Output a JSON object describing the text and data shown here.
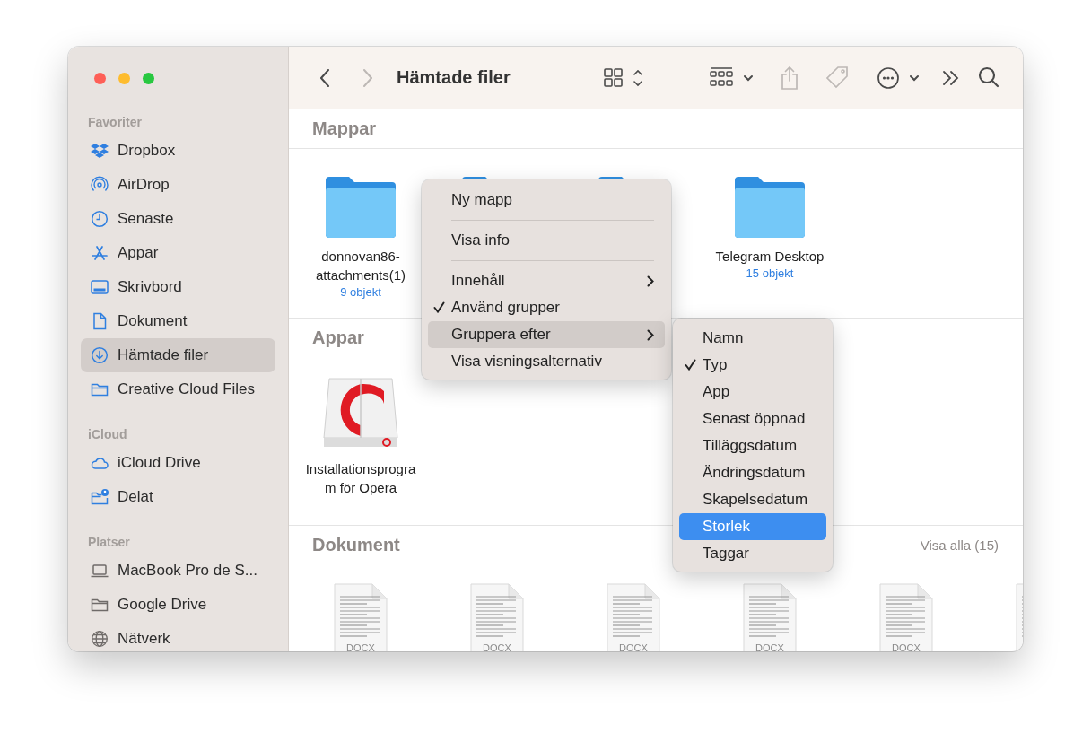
{
  "window": {
    "title": "Hämtade filer"
  },
  "toolbar": [
    {
      "kind": "back",
      "disabled": false
    },
    {
      "kind": "forward",
      "disabled": true
    },
    {
      "kind": "view",
      "disabled": false
    },
    {
      "kind": "group",
      "disabled": false
    },
    {
      "kind": "share",
      "disabled": true
    },
    {
      "kind": "tag",
      "disabled": true
    },
    {
      "kind": "more",
      "disabled": false
    },
    {
      "kind": "overflow",
      "disabled": false
    },
    {
      "kind": "search",
      "disabled": false
    }
  ],
  "sidebar": {
    "sections": [
      {
        "title": "Favoriter",
        "items": [
          {
            "label": "Dropbox",
            "kind": "dropbox",
            "selected": false
          },
          {
            "label": "AirDrop",
            "kind": "airdrop",
            "selected": false
          },
          {
            "label": "Senaste",
            "kind": "clock",
            "selected": false
          },
          {
            "label": "Appar",
            "kind": "apps",
            "selected": false
          },
          {
            "label": "Skrivbord",
            "kind": "desktop",
            "selected": false
          },
          {
            "label": "Dokument",
            "kind": "document",
            "selected": false
          },
          {
            "label": "Hämtade filer",
            "kind": "download",
            "selected": true
          },
          {
            "label": "Creative Cloud Files",
            "kind": "folder",
            "selected": false
          }
        ]
      },
      {
        "title": "iCloud",
        "items": [
          {
            "label": "iCloud Drive",
            "kind": "cloud",
            "selected": false
          },
          {
            "label": "Delat",
            "kind": "shared",
            "selected": false
          }
        ]
      },
      {
        "title": "Platser",
        "items": [
          {
            "label": "MacBook Pro de S...",
            "kind": "laptop",
            "selected": false
          },
          {
            "label": "Google Drive",
            "kind": "drive-folder",
            "selected": false
          },
          {
            "label": "Nätverk",
            "kind": "globe",
            "selected": false
          }
        ]
      }
    ]
  },
  "content": {
    "sections": [
      {
        "title": "Mappar",
        "items": [
          {
            "kind": "folder",
            "name": "donnovan86-attachments(1)",
            "count": "9 objekt"
          },
          {
            "kind": "folder"
          },
          {
            "kind": "folder"
          },
          {
            "kind": "folder",
            "name": "Telegram Desktop",
            "count": "15 objekt"
          }
        ]
      },
      {
        "title": "Appar",
        "items": [
          {
            "kind": "app",
            "name": "Installationsprogram för Opera"
          }
        ]
      },
      {
        "title": "Dokument",
        "action": "Visa alla (15)",
        "items": [
          {
            "kind": "document",
            "badge": "DOCX"
          },
          {
            "kind": "document",
            "badge": "DOCX"
          },
          {
            "kind": "document",
            "badge": "DOCX"
          },
          {
            "kind": "document",
            "badge": "DOCX"
          },
          {
            "kind": "document",
            "badge": "DOCX"
          },
          {
            "kind": "document"
          }
        ]
      }
    ]
  },
  "context_menu": {
    "items": [
      {
        "kind": "item",
        "label": "Ny mapp",
        "checked": false,
        "submenu": false,
        "highlighted": false
      },
      {
        "kind": "separator"
      },
      {
        "kind": "item",
        "label": "Visa info",
        "checked": false,
        "submenu": false,
        "highlighted": false
      },
      {
        "kind": "separator"
      },
      {
        "kind": "item",
        "label": "Innehåll",
        "checked": false,
        "submenu": true,
        "highlighted": false
      },
      {
        "kind": "item",
        "label": "Använd grupper",
        "checked": true,
        "submenu": false,
        "highlighted": false
      },
      {
        "kind": "item",
        "label": "Gruppera efter",
        "checked": false,
        "submenu": true,
        "highlighted": true
      },
      {
        "kind": "item",
        "label": "Visa visningsalternativ",
        "checked": false,
        "submenu": false,
        "highlighted": false
      }
    ]
  },
  "submenu": {
    "items": [
      {
        "label": "Namn",
        "checked": false,
        "selected": false
      },
      {
        "label": "Typ",
        "checked": true,
        "selected": false
      },
      {
        "label": "App",
        "checked": false,
        "selected": false
      },
      {
        "label": "Senast öppnad",
        "checked": false,
        "selected": false
      },
      {
        "label": "Tilläggsdatum",
        "checked": false,
        "selected": false
      },
      {
        "label": "Ändringsdatum",
        "checked": false,
        "selected": false
      },
      {
        "label": "Skapelsedatum",
        "checked": false,
        "selected": false
      },
      {
        "label": "Storlek",
        "checked": false,
        "selected": true
      },
      {
        "label": "Taggar",
        "checked": false,
        "selected": false
      }
    ]
  }
}
